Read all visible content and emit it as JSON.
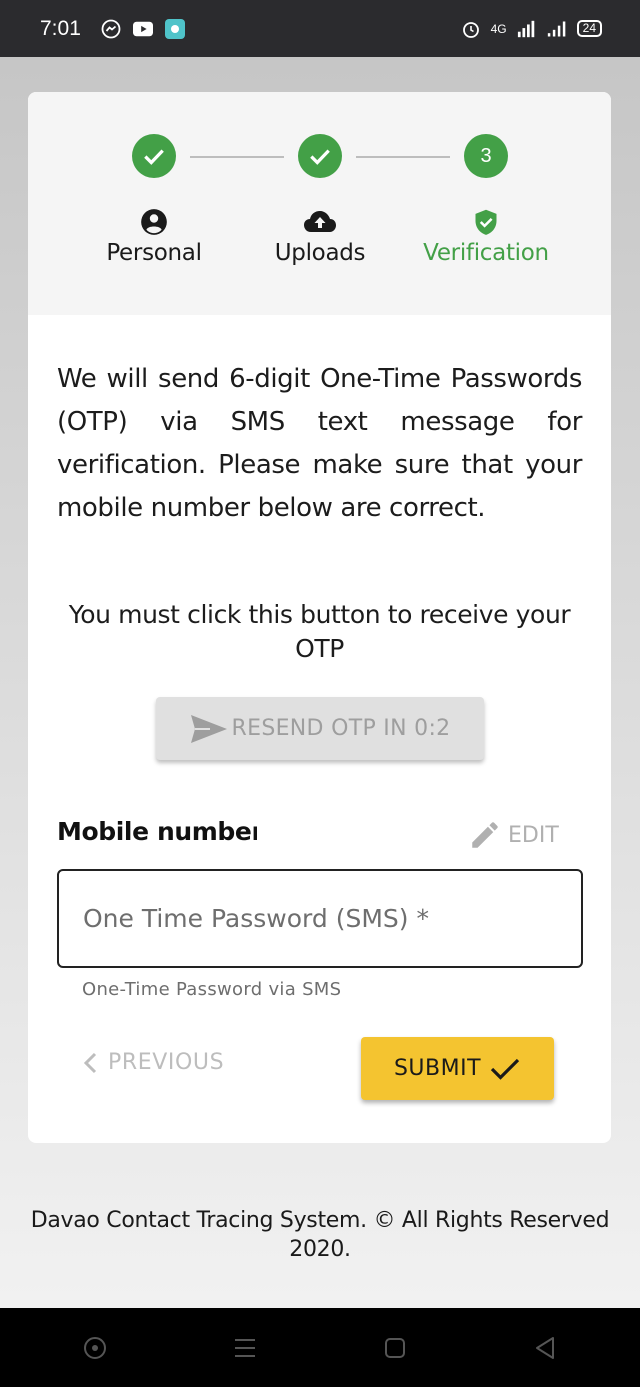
{
  "status_bar": {
    "time": "7:01",
    "network": "4G",
    "battery": "24"
  },
  "stepper": {
    "steps": [
      {
        "label": "Personal",
        "state": "completed",
        "icon": "account-circle-icon"
      },
      {
        "label": "Uploads",
        "state": "completed",
        "icon": "cloud-upload-icon"
      },
      {
        "label": "Verification",
        "state": "active",
        "number": "3",
        "icon": "shield-check-icon"
      }
    ]
  },
  "content": {
    "description": "We will send 6-digit One-Time Passwords (OTP) via SMS text message for verification. Please make sure that your mobile number below are correct.",
    "instruction": "You must click this button to receive your OTP",
    "resend_label": "RESEND OTP IN 0:2",
    "mobile_label": "Mobile number:",
    "edit_label": "EDIT",
    "otp_placeholder": "One Time Password (SMS) *",
    "otp_helper": "One-Time Password via SMS",
    "previous_label": "PREVIOUS",
    "submit_label": "SUBMIT"
  },
  "footer": {
    "text": "Davao Contact Tracing System. © All Rights Reserved 2020."
  },
  "colors": {
    "accent_green": "#43a047",
    "submit_yellow": "#f4c430",
    "disabled_gray": "#9e9e9e"
  }
}
